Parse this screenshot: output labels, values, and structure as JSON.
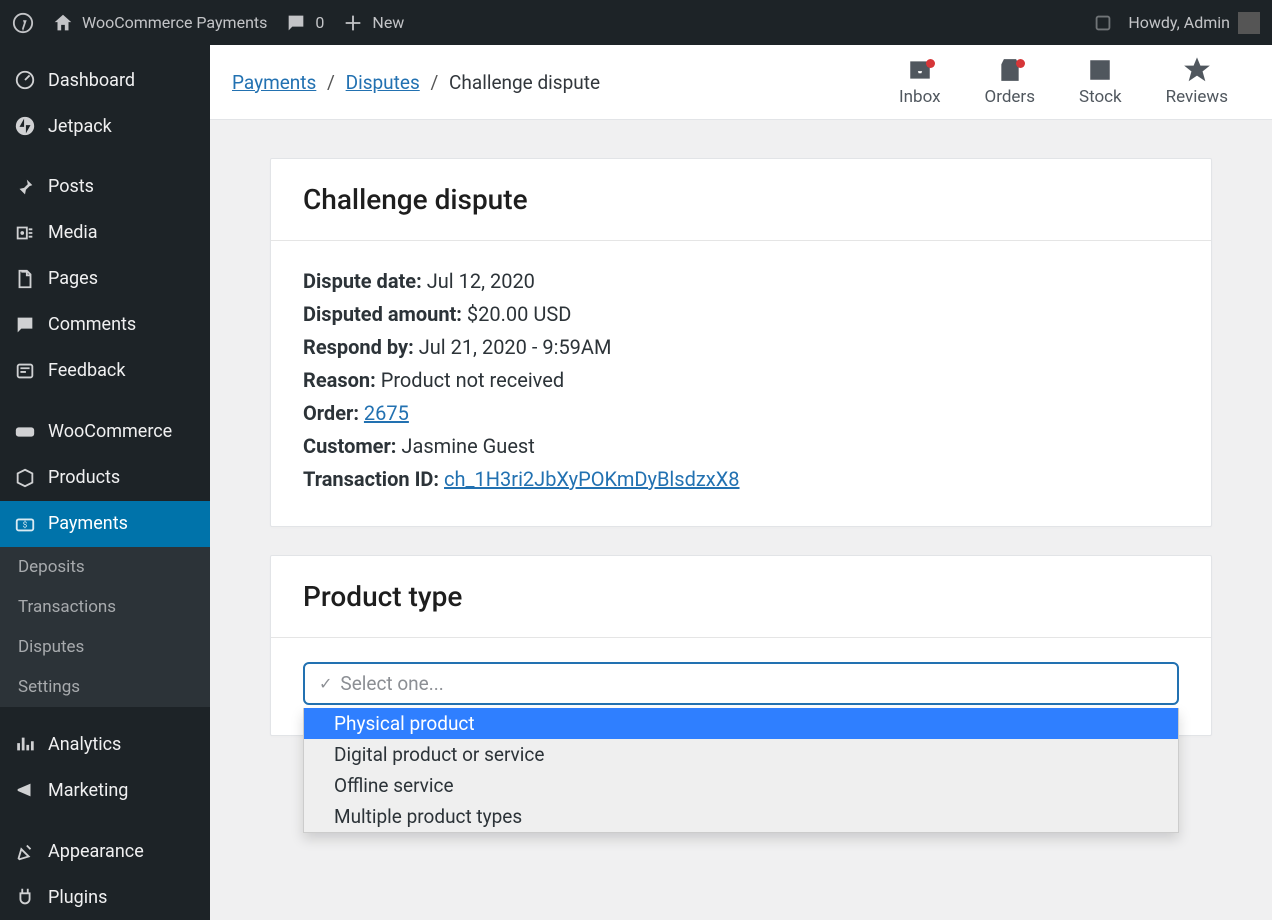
{
  "adminbar": {
    "site_title": "WooCommerce Payments",
    "comments_count": "0",
    "new_label": "New",
    "howdy": "Howdy, Admin"
  },
  "sidebar": {
    "items": [
      {
        "label": "Dashboard",
        "icon": "dashboard"
      },
      {
        "label": "Jetpack",
        "icon": "jetpack"
      },
      {
        "label": "Posts",
        "icon": "pin"
      },
      {
        "label": "Media",
        "icon": "media"
      },
      {
        "label": "Pages",
        "icon": "pages"
      },
      {
        "label": "Comments",
        "icon": "comments"
      },
      {
        "label": "Feedback",
        "icon": "feedback"
      },
      {
        "label": "WooCommerce",
        "icon": "woo"
      },
      {
        "label": "Products",
        "icon": "products"
      },
      {
        "label": "Payments",
        "icon": "payments"
      },
      {
        "label": "Analytics",
        "icon": "analytics"
      },
      {
        "label": "Marketing",
        "icon": "marketing"
      },
      {
        "label": "Appearance",
        "icon": "appearance"
      },
      {
        "label": "Plugins",
        "icon": "plugins"
      }
    ],
    "subitems": [
      {
        "label": "Deposits"
      },
      {
        "label": "Transactions"
      },
      {
        "label": "Disputes"
      },
      {
        "label": "Settings"
      }
    ]
  },
  "breadcrumbs": {
    "a": "Payments",
    "b": "Disputes",
    "c": "Challenge dispute"
  },
  "shortcuts": {
    "inbox": "Inbox",
    "orders": "Orders",
    "stock": "Stock",
    "reviews": "Reviews"
  },
  "dispute": {
    "heading": "Challenge dispute",
    "labels": {
      "date": "Dispute date:",
      "amount": "Disputed amount:",
      "respond": "Respond by:",
      "reason": "Reason:",
      "order": "Order:",
      "customer": "Customer:",
      "txn": "Transaction ID:"
    },
    "values": {
      "date": "Jul 12, 2020",
      "amount": "$20.00 USD",
      "respond": "Jul 21, 2020 - 9:59AM",
      "reason": "Product not received",
      "order": "2675",
      "customer": "Jasmine Guest",
      "txn": "ch_1H3ri2JbXyPOKmDyBlsdzxX8"
    }
  },
  "product_type": {
    "heading": "Product type",
    "placeholder": "Select one...",
    "options": [
      "Physical product",
      "Digital product or service",
      "Offline service",
      "Multiple product types"
    ]
  }
}
